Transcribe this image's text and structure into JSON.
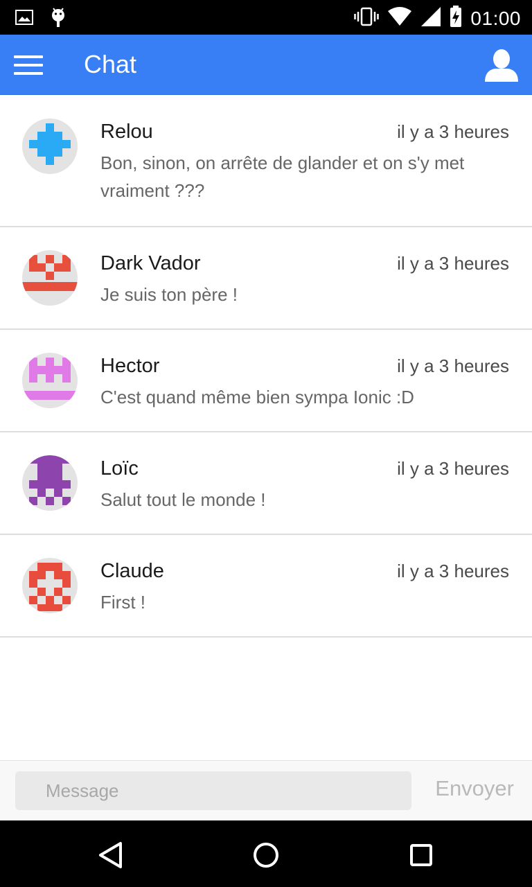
{
  "status_bar": {
    "time": "01:00",
    "left_icons": [
      "gallery-icon",
      "android-icon"
    ],
    "right_icons": [
      "vibrate-icon",
      "wifi-icon",
      "signal-icon",
      "battery-charging-icon"
    ]
  },
  "toolbar": {
    "title": "Chat",
    "menu_icon": "hamburger-menu-icon",
    "profile_icon": "person-icon",
    "color": "#387ef5"
  },
  "chats": [
    {
      "name": "Relou",
      "time": "il y a 3 heures",
      "message": "Bon, sinon, on arrête de glander et on s'y met vraiment ???",
      "avatar_color": "#2aa9f4"
    },
    {
      "name": "Dark Vador",
      "time": "il y a 3 heures",
      "message": "Je suis ton père !",
      "avatar_color": "#e8503e"
    },
    {
      "name": "Hector",
      "time": "il y a 3 heures",
      "message": "C'est quand même bien sympa Ionic :D",
      "avatar_color": "#e07ae6"
    },
    {
      "name": "Loïc",
      "time": "il y a 3 heures",
      "message": "Salut tout le monde !",
      "avatar_color": "#8e44ad"
    },
    {
      "name": "Claude",
      "time": "il y a 3 heures",
      "message": "First !",
      "avatar_color": "#e74c3c"
    }
  ],
  "footer": {
    "input_placeholder": "Message",
    "input_value": "",
    "send_label": "Envoyer"
  },
  "nav_bar": {
    "icons": [
      "back-icon",
      "home-icon",
      "recents-icon"
    ]
  }
}
